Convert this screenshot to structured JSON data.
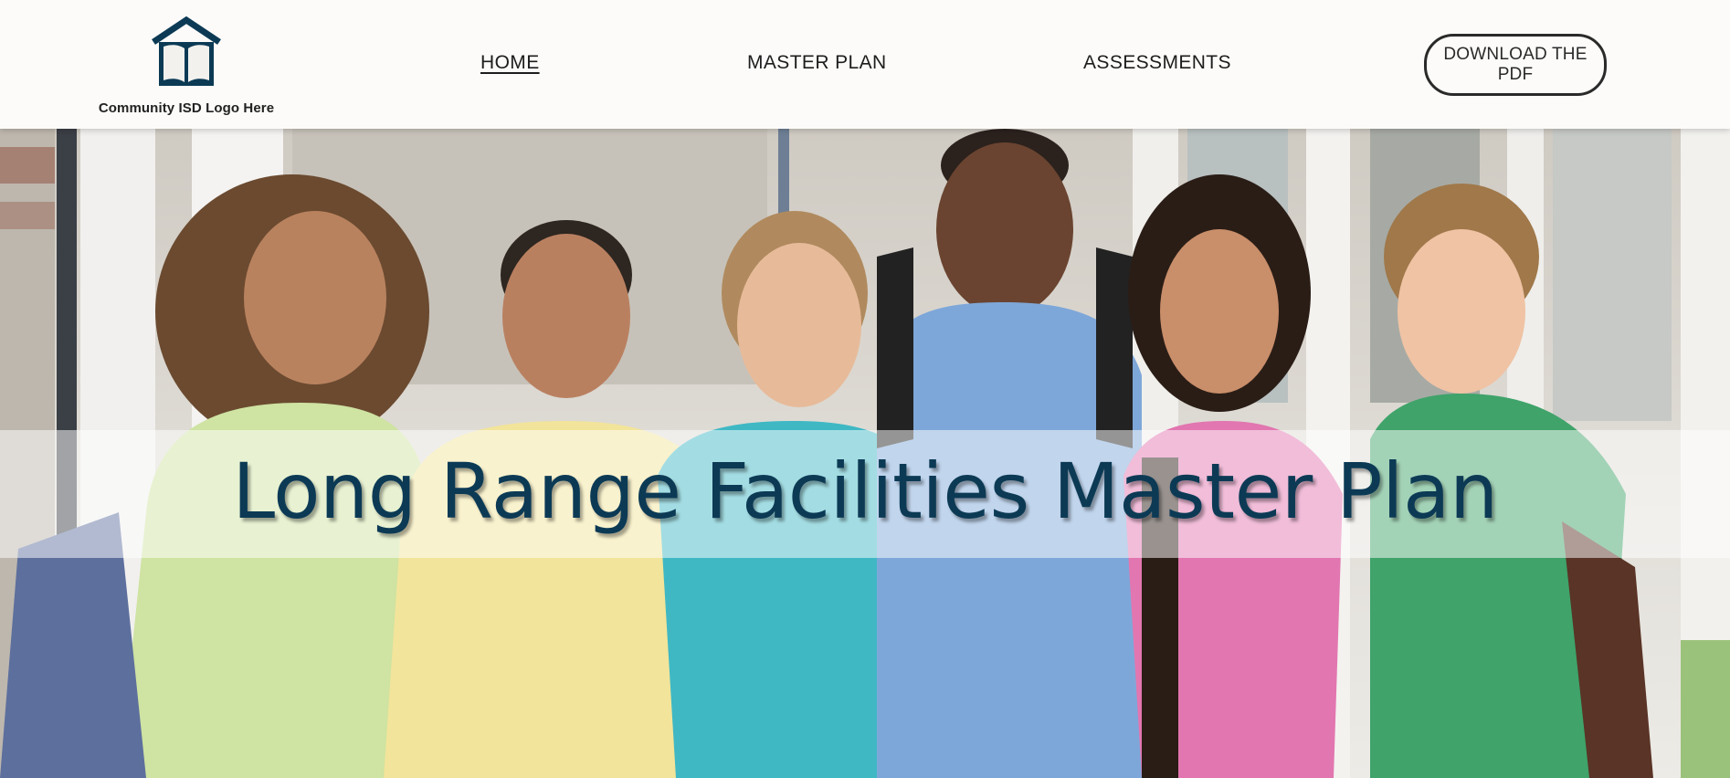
{
  "header": {
    "logo": {
      "icon": "house-book-icon",
      "caption": "Community ISD Logo Here"
    },
    "nav": {
      "home": "HOME",
      "master_plan": "MASTER PLAN",
      "assessments": "ASSESSMENTS"
    },
    "cta_label": "DOWNLOAD THE PDF"
  },
  "hero": {
    "title": "Long Range Facilities Master Plan",
    "image": "group-of-six-smiling-students-photo"
  },
  "colors": {
    "brand": "#0c3a55",
    "header_bg": "#fcfbf9",
    "text": "#1d1d1d"
  }
}
